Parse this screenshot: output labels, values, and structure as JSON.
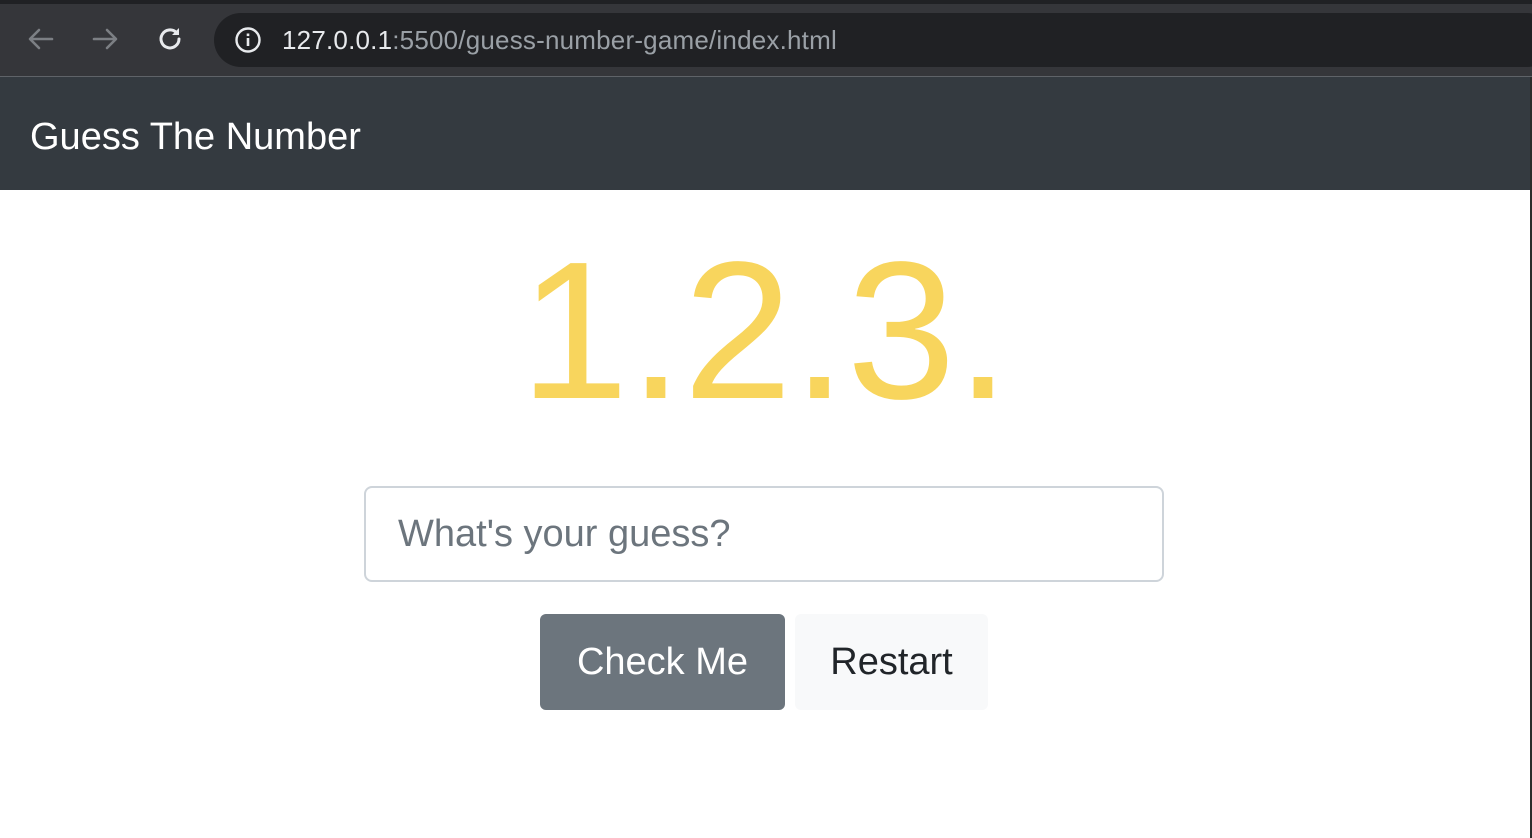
{
  "browser": {
    "url_host": "127.0.0.1",
    "url_rest": ":5500/guess-number-game/index.html"
  },
  "navbar": {
    "brand": "Guess The Number"
  },
  "main": {
    "display_text": "1.2.3.",
    "display_color": "#f8d55d",
    "guess_input": {
      "value": "",
      "placeholder": "What's your guess?"
    },
    "check_button_label": "Check Me",
    "restart_button_label": "Restart"
  },
  "icons": {
    "back": "arrow-left-icon",
    "forward": "arrow-right-icon",
    "reload": "reload-icon",
    "site_info": "info-circle-icon"
  },
  "colors": {
    "navbar_bg": "#343a40",
    "check_button_bg": "#6c757d",
    "restart_button_bg": "#f8f9fa"
  }
}
